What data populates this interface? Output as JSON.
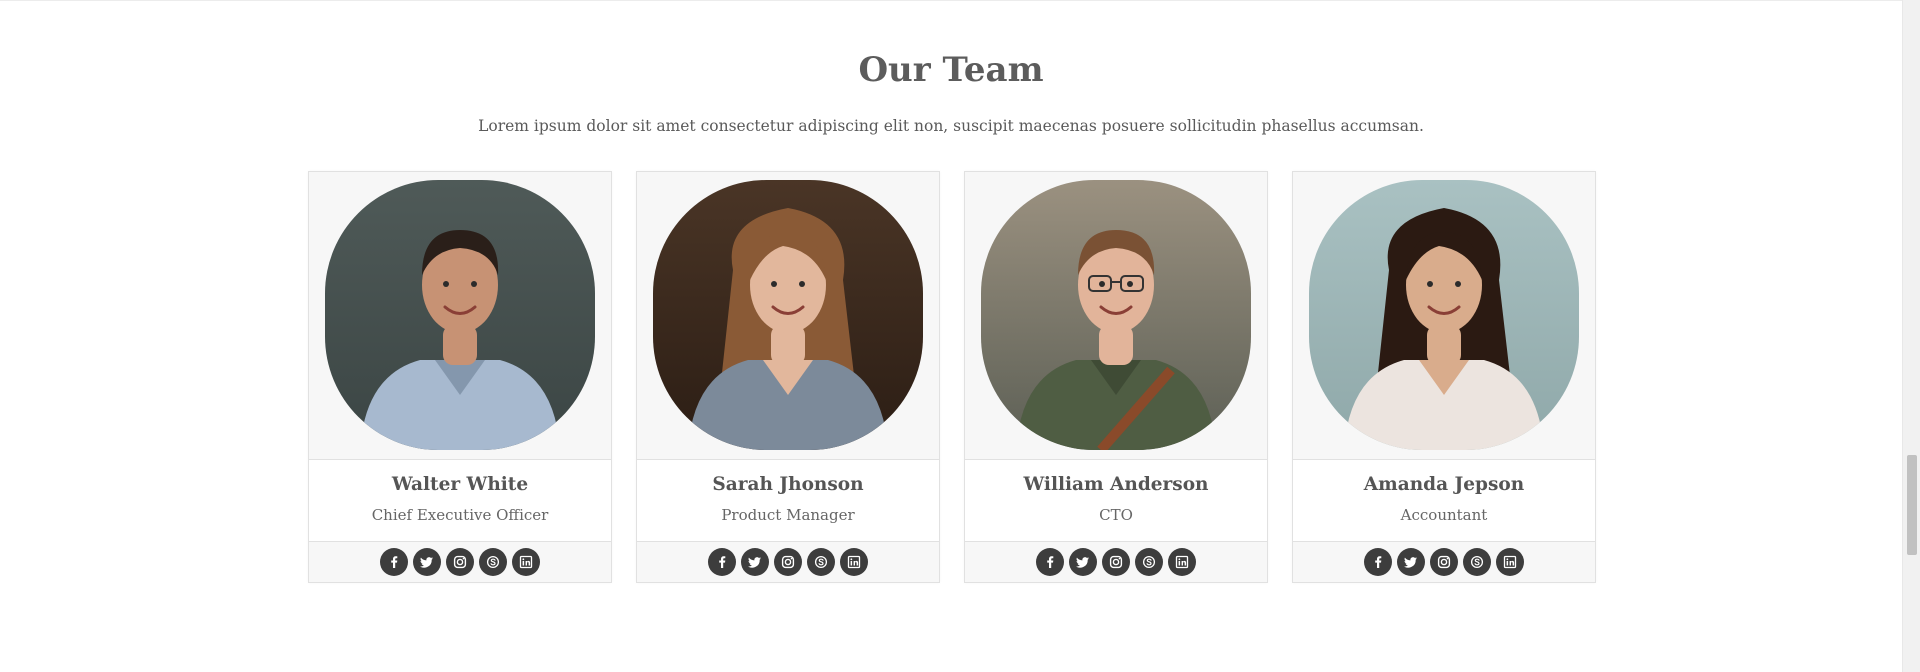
{
  "section": {
    "title": "Our Team",
    "subtitle": "Lorem ipsum dolor sit amet consectetur adipiscing elit non, suscipit maecenas posuere sollicitudin phasellus accumsan."
  },
  "team": [
    {
      "name": "Walter White",
      "role": "Chief Executive Officer",
      "photo_colors": {
        "bg_top": "#4f5a58",
        "bg_bottom": "#3b4544",
        "skin": "#c79274",
        "hair": "#2a1f19",
        "shirt": "#a7b9cf",
        "shirt_dark": "#8497ad"
      }
    },
    {
      "name": "Sarah Jhonson",
      "role": "Product Manager",
      "photo_colors": {
        "bg_top": "#4a3526",
        "bg_bottom": "#2b1d14",
        "skin": "#e2b79c",
        "hair": "#8a5a36",
        "shirt": "#7c8a9a",
        "shirt_dark": "#66717f"
      }
    },
    {
      "name": "William Anderson",
      "role": "CTO",
      "photo_colors": {
        "bg_top": "#9b9180",
        "bg_bottom": "#5c5f55",
        "skin": "#e2b49a",
        "hair": "#7a5134",
        "shirt": "#4f5d43",
        "shirt_dark": "#3f4b35"
      }
    },
    {
      "name": "Amanda Jepson",
      "role": "Accountant",
      "photo_colors": {
        "bg_top": "#a9c1c2",
        "bg_bottom": "#8fa8a9",
        "skin": "#d9ac8c",
        "hair": "#2b1a12",
        "shirt": "#ece4df",
        "shirt_dark": "#d8cdc6"
      }
    }
  ],
  "socials": [
    {
      "icon": "facebook-icon"
    },
    {
      "icon": "twitter-icon"
    },
    {
      "icon": "instagram-icon"
    },
    {
      "icon": "skype-icon"
    },
    {
      "icon": "linkedin-icon"
    }
  ],
  "colors": {
    "social_bg": "#3d3d3d",
    "card_bg": "#f7f7f7",
    "card_border": "#e1e1e1",
    "title": "#5c5c5c"
  }
}
